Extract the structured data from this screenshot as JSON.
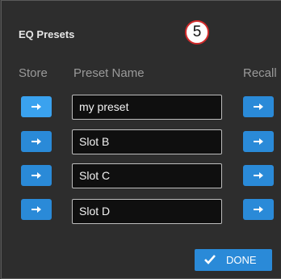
{
  "dialog": {
    "title": "EQ Presets",
    "callout_number": "5"
  },
  "columns": {
    "store": "Store",
    "name": "Preset Name",
    "recall": "Recall"
  },
  "presets": [
    {
      "name": "my preset",
      "store_active": true
    },
    {
      "name": "Slot B",
      "store_active": false
    },
    {
      "name": "Slot C",
      "store_active": false
    },
    {
      "name": "Slot D",
      "store_active": false
    }
  ],
  "done_button": {
    "label": "DONE",
    "icon": "checkmark-icon"
  },
  "icons": {
    "store": "arrow-right-icon",
    "recall": "arrow-right-icon"
  },
  "colors": {
    "background": "#2d2d2d",
    "accent": "#2a8ad8",
    "accent_active": "#3aa2ef",
    "field_bg": "#0f0f0f",
    "callout_border": "#d22b2b"
  }
}
